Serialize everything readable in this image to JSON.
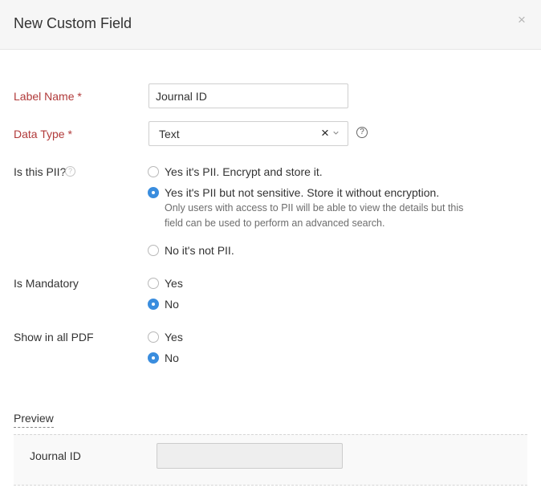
{
  "dialog": {
    "title": "New Custom Field",
    "close_symbol": "×"
  },
  "label_name": {
    "label": "Label Name *",
    "value": "Journal ID"
  },
  "data_type": {
    "label": "Data Type *",
    "value": "Text",
    "clear_symbol": "×",
    "help_symbol": "?"
  },
  "pii": {
    "label": "Is this PII?",
    "help_symbol": "?",
    "options": [
      {
        "label": "Yes it's PII. Encrypt and store it.",
        "checked": false
      },
      {
        "label": "Yes it's PII but not sensitive. Store it without encryption.",
        "checked": true,
        "description": "Only users with access to PII will be able to view the details but this field can be used to perform an advanced search."
      },
      {
        "label": "No it's not PII.",
        "checked": false
      }
    ]
  },
  "mandatory": {
    "label": "Is Mandatory",
    "options": [
      {
        "label": "Yes",
        "checked": false
      },
      {
        "label": "No",
        "checked": true
      }
    ]
  },
  "show_pdf": {
    "label": "Show in all PDF",
    "options": [
      {
        "label": "Yes",
        "checked": false
      },
      {
        "label": "No",
        "checked": true
      }
    ]
  },
  "preview": {
    "heading": "Preview",
    "field_label": "Journal ID",
    "field_value": ""
  },
  "colors": {
    "accent": "#3a8dde",
    "required_label": "#b13a3a",
    "header_bg": "#f6f6f6"
  },
  "icons": {
    "close": "close-icon",
    "clear": "clear-icon",
    "caret": "chevron-down-icon",
    "help": "help-icon"
  }
}
